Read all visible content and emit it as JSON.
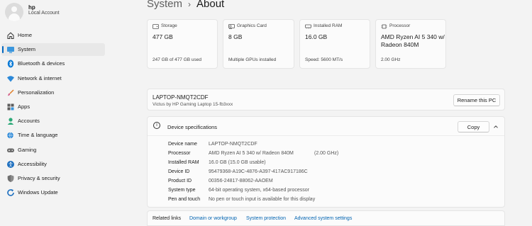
{
  "user": {
    "name": "hp",
    "account_type": "Local Account"
  },
  "sidebar": {
    "items": [
      {
        "label": "Home",
        "icon": "home-icon",
        "selected": false
      },
      {
        "label": "System",
        "icon": "system-icon",
        "selected": true
      },
      {
        "label": "Bluetooth & devices",
        "icon": "bluetooth-icon",
        "selected": false
      },
      {
        "label": "Network & internet",
        "icon": "wifi-icon",
        "selected": false
      },
      {
        "label": "Personalization",
        "icon": "brush-icon",
        "selected": false
      },
      {
        "label": "Apps",
        "icon": "apps-icon",
        "selected": false
      },
      {
        "label": "Accounts",
        "icon": "accounts-icon",
        "selected": false
      },
      {
        "label": "Time & language",
        "icon": "globe-clock-icon",
        "selected": false
      },
      {
        "label": "Gaming",
        "icon": "gamepad-icon",
        "selected": false
      },
      {
        "label": "Accessibility",
        "icon": "accessibility-icon",
        "selected": false
      },
      {
        "label": "Privacy & security",
        "icon": "shield-icon",
        "selected": false
      },
      {
        "label": "Windows Update",
        "icon": "update-icon",
        "selected": false
      }
    ]
  },
  "breadcrumb": {
    "parent": "System",
    "separator": "›",
    "current": "About"
  },
  "cards": [
    {
      "label": "Storage",
      "value": "477 GB",
      "sub": "247 GB of 477 GB used",
      "icon": "storage-icon"
    },
    {
      "label": "Graphics Card",
      "value": "8 GB",
      "sub": "Multiple GPUs installed",
      "icon": "graphics-card-icon"
    },
    {
      "label": "Installed RAM",
      "value": "16.0 GB",
      "sub": "Speed: 5600 MT/s",
      "icon": "ram-icon"
    },
    {
      "label": "Processor",
      "value": "AMD Ryzen AI 5 340 w/ Radeon 840M",
      "sub": "2.00 GHz",
      "icon": "processor-icon"
    }
  ],
  "pc": {
    "name": "LAPTOP-NMQT2CDF",
    "model": "Victus by HP Gaming Laptop 15-fb3xxx",
    "rename_label": "Rename this PC"
  },
  "specs": {
    "title": "Device specifications",
    "copy_label": "Copy",
    "rows": [
      {
        "key": "Device name",
        "value": "LAPTOP-NMQT2CDF",
        "extra": ""
      },
      {
        "key": "Processor",
        "value": "AMD Ryzen AI 5 340 w/ Radeon 840M",
        "extra": "(2.00 GHz)"
      },
      {
        "key": "Installed RAM",
        "value": "16.0 GB (15.0 GB usable)",
        "extra": ""
      },
      {
        "key": "Device ID",
        "value": "95479368-A19C-4876-A397-417AC917186C",
        "extra": ""
      },
      {
        "key": "Product ID",
        "value": "00356-24817-88062-AAOEM",
        "extra": ""
      },
      {
        "key": "System type",
        "value": "64-bit operating system, x64-based processor",
        "extra": ""
      },
      {
        "key": "Pen and touch",
        "value": "No pen or touch input is available for this display",
        "extra": ""
      }
    ]
  },
  "related": {
    "label": "Related links",
    "links": [
      "Domain or workgroup",
      "System protection",
      "Advanced system settings"
    ]
  },
  "colors": {
    "accent": "#0067c0",
    "link": "#0063b1",
    "background": "#f3f3f3",
    "card": "#fbfbfb"
  }
}
